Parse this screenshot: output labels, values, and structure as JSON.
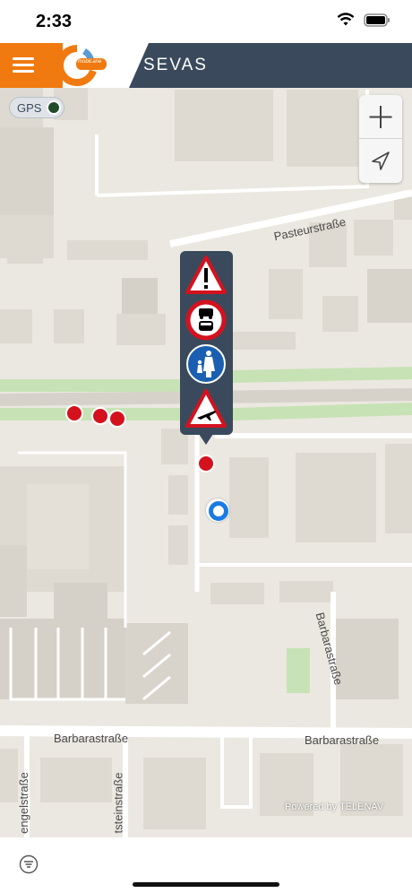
{
  "status_bar": {
    "time": "2:33",
    "icons": [
      "wifi-icon",
      "battery-icon"
    ]
  },
  "header": {
    "title": "SEVAS",
    "logo_text": "mobiLane",
    "brand_orange": "#f07a10",
    "header_color": "#3a4a5c"
  },
  "map": {
    "gps_label": "GPS",
    "gps_enabled": true,
    "roads": [
      {
        "name": "Pasteurstraße"
      },
      {
        "name": "Barbarastraße"
      },
      {
        "name": "Barbarastraße"
      },
      {
        "name": "Barbarastraße"
      },
      {
        "name": "engelstraße"
      },
      {
        "name": "tsteinstraße"
      }
    ],
    "attribution": "Powered by TELENAV",
    "controls": {
      "zoom_in": "plus-icon",
      "locate": "navigation-arrow-icon"
    },
    "signs": [
      {
        "name": "warning-sign-icon",
        "meaning": "Danger"
      },
      {
        "name": "no-motor-vehicles-sign-icon",
        "meaning": "No motor vehicles"
      },
      {
        "name": "pedestrian-zone-sign-icon",
        "meaning": "Pedestrian path"
      },
      {
        "name": "aircraft-warning-sign-icon",
        "meaning": "Low-flying aircraft"
      }
    ],
    "incident_color": "#d4121e",
    "location_color": "#1b7be3"
  },
  "bottom_bar": {
    "filter_icon": "filter-icon"
  }
}
